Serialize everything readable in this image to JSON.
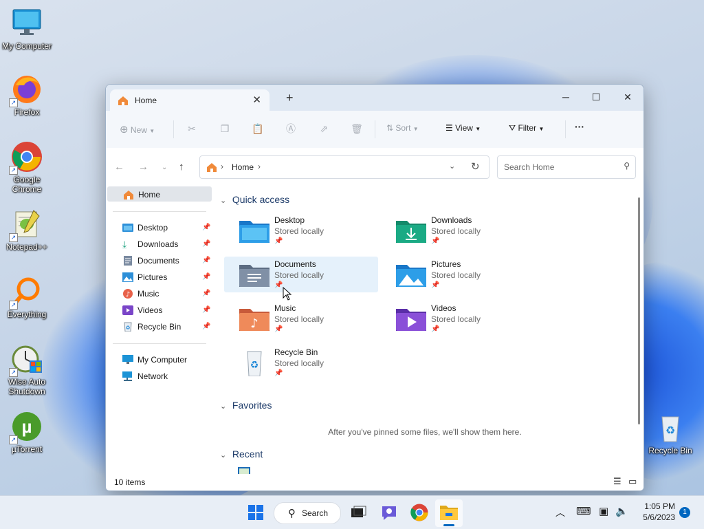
{
  "desktop": {
    "icons": [
      {
        "label": "My Computer"
      },
      {
        "label": "Firefox"
      },
      {
        "label": "Google Chrome"
      },
      {
        "label": "Notepad++"
      },
      {
        "label": "Everything"
      },
      {
        "label": "Wise Auto Shutdown"
      },
      {
        "label": "µTorrent"
      },
      {
        "label": "Recycle Bin"
      }
    ]
  },
  "window": {
    "tab_title": "Home",
    "toolbar": {
      "new": "New",
      "sort": "Sort",
      "view": "View",
      "filter": "Filter",
      "more": "···"
    },
    "address": {
      "breadcrumb": "Home",
      "search_placeholder": "Search Home"
    },
    "nav": {
      "home": "Home",
      "pinned": [
        {
          "label": "Desktop"
        },
        {
          "label": "Downloads"
        },
        {
          "label": "Documents"
        },
        {
          "label": "Pictures"
        },
        {
          "label": "Music"
        },
        {
          "label": "Videos"
        },
        {
          "label": "Recycle Bin"
        }
      ],
      "this_pc": [
        {
          "label": "My Computer"
        },
        {
          "label": "Network"
        }
      ]
    },
    "content": {
      "quick_access_heading": "Quick access",
      "quick_access": [
        {
          "name": "Desktop",
          "sub": "Stored locally"
        },
        {
          "name": "Downloads",
          "sub": "Stored locally"
        },
        {
          "name": "Documents",
          "sub": "Stored locally"
        },
        {
          "name": "Pictures",
          "sub": "Stored locally"
        },
        {
          "name": "Music",
          "sub": "Stored locally"
        },
        {
          "name": "Videos",
          "sub": "Stored locally"
        },
        {
          "name": "Recycle Bin",
          "sub": "Stored locally"
        }
      ],
      "favorites_heading": "Favorites",
      "favorites_empty": "After you've pinned some files, we'll show them here.",
      "recent_heading": "Recent"
    },
    "status": {
      "count": "10 items"
    }
  },
  "taskbar": {
    "search_label": "Search",
    "time": "1:05 PM",
    "date": "5/6/2023",
    "notification_count": "1"
  },
  "colors": {
    "accent": "#0067c0",
    "folder_blue": "#2d8fd8",
    "folder_teal": "#1aa07e",
    "selected": "#e5f1fb"
  }
}
